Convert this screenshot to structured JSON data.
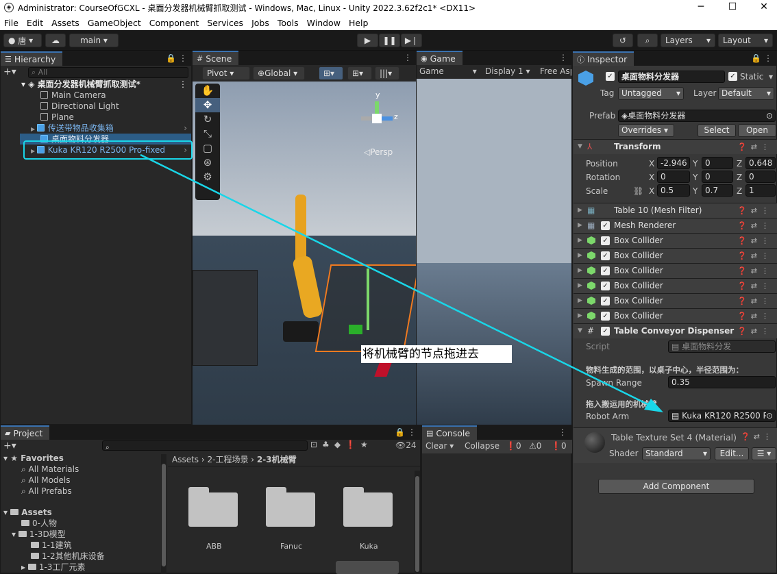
{
  "window": {
    "title": "Administrator: CourseOfGCXL - 桌面分发器机械臂抓取测试 - Windows, Mac, Linux - Unity 2022.3.62f2c1* <DX11>",
    "min": "─",
    "max": "☐",
    "close": "✕"
  },
  "menu": [
    "File",
    "Edit",
    "Assets",
    "GameObject",
    "Component",
    "Services",
    "Jobs",
    "Tools",
    "Window",
    "Help"
  ],
  "toolbar": {
    "account": "唐",
    "branch": "main",
    "layers": "Layers",
    "layout": "Layout"
  },
  "hierarchy": {
    "tab": "Hierarchy",
    "search_placeholder": "All",
    "scene": "桌面分发器机械臂抓取测试*",
    "items": [
      {
        "label": "Main Camera",
        "prefab": false
      },
      {
        "label": "Directional Light",
        "prefab": false
      },
      {
        "label": "Plane",
        "prefab": false
      },
      {
        "label": "传送带物品收集箱",
        "prefab": true
      },
      {
        "label": "桌面物料分发器",
        "prefab": true
      },
      {
        "label": "Kuka KR120 R2500 Pro-fixed",
        "prefab": true
      }
    ]
  },
  "scene": {
    "tab": "Scene",
    "pivot": "Pivot",
    "global": "Global",
    "persp": "◁Persp",
    "axis_y": "y",
    "axis_z": "z"
  },
  "game": {
    "tab": "Game",
    "mode": "Game",
    "display": "Display 1",
    "aspect": "Free Asp"
  },
  "annotation": "将机械臂的节点拖进去",
  "inspector": {
    "tab": "Inspector",
    "object_name": "桌面物料分发器",
    "static": "Static",
    "tag_label": "Tag",
    "tag": "Untagged",
    "layer_label": "Layer",
    "layer": "Default",
    "prefab_label": "Prefab",
    "prefab": "桌面物料分发器",
    "overrides": "Overrides",
    "select": "Select",
    "open": "Open",
    "transform": {
      "title": "Transform",
      "position_label": "Position",
      "rotation_label": "Rotation",
      "scale_label": "Scale",
      "position": [
        "-2.946",
        "0",
        "0.648"
      ],
      "rotation": [
        "0",
        "0",
        "0"
      ],
      "scale": [
        "0.5",
        "0.7",
        "1"
      ]
    },
    "components": [
      "Table 10 (Mesh Filter)",
      "Mesh Renderer",
      "Box Collider",
      "Box Collider",
      "Box Collider",
      "Box Collider",
      "Box Collider",
      "Box Collider",
      "Table Conveyor Dispenser (Sc"
    ],
    "script_label": "Script",
    "script": "桌面物料分发",
    "spawn_header": "物料生成的范围，以桌子中心，半径范围为：",
    "spawn_label": "Spawn Range",
    "spawn_value": "0.35",
    "robot_header": "拖入搬运用的机械臂",
    "robot_label": "Robot Arm",
    "robot_value": "Kuka KR120 R2500 P",
    "material": "Table Texture Set 4 (Material)",
    "shader_label": "Shader",
    "shader": "Standard",
    "edit": "Edit...",
    "add_component": "Add Component"
  },
  "project": {
    "tab": "Project",
    "favorites": "Favorites",
    "fav_items": [
      "All Materials",
      "All Models",
      "All Prefabs"
    ],
    "assets": "Assets",
    "tree": [
      "0-人物",
      "1-3D模型",
      "1-1建筑",
      "1-2其他机床设备",
      "1-3工厂元素"
    ],
    "breadcrumb": [
      "Assets",
      "2-工程场景",
      "2-3机械臂"
    ],
    "folders": [
      "ABB",
      "Fanuc",
      "Kuka"
    ],
    "count": "24"
  },
  "console": {
    "tab": "Console",
    "clear": "Clear",
    "collapse": "Collapse",
    "err": "0",
    "warn": "0",
    "info": "0"
  },
  "colors": {
    "accent": "#3a72b0",
    "highlight": "#19d6e8",
    "prefab_blue": "#7bb6f0"
  }
}
